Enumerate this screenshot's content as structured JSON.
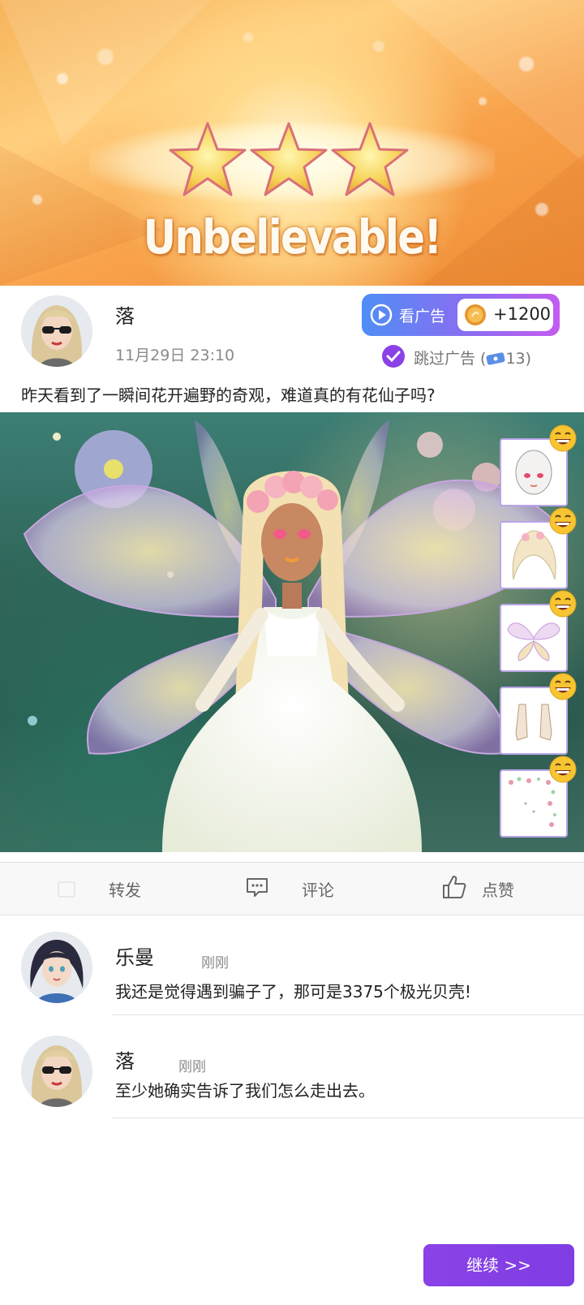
{
  "banner": {
    "stars_earned": 3,
    "stars_total": 3,
    "title": "Unbelievable!"
  },
  "post": {
    "author": "落",
    "timestamp": "11月29日 23:10",
    "text": "昨天看到了一瞬间花开遍野的奇观，难道真的有花仙子吗?",
    "watch_ad_label": "看广告",
    "reward_amount": "+1200",
    "skip_ad_label": "跳过广告 (",
    "skip_ad_count": "13)"
  },
  "outfit_items": [
    {
      "name": "face-item",
      "rating_icon": "laughing-emoji-icon"
    },
    {
      "name": "hair-item",
      "rating_icon": "laughing-emoji-icon"
    },
    {
      "name": "wings-item",
      "rating_icon": "laughing-emoji-icon"
    },
    {
      "name": "shoes-item",
      "rating_icon": "laughing-emoji-icon"
    },
    {
      "name": "background-item",
      "rating_icon": "laughing-emoji-icon"
    }
  ],
  "actions": {
    "share_label": "转发",
    "comment_label": "评论",
    "like_label": "点赞"
  },
  "comments": [
    {
      "author": "乐曼",
      "time": "刚刚",
      "text": "我还是觉得遇到骗子了，那可是3375个极光贝壳!"
    },
    {
      "author": "落",
      "time": "刚刚",
      "text": "至少她确实告诉了我们怎么走出去。"
    }
  ],
  "continue_label": "继续 >>",
  "colors": {
    "accent_purple": "#7f3de3",
    "banner_orange": "#f8a24b",
    "ad_gradient_start": "#4f8ef5",
    "ad_gradient_end": "#c45cf0"
  }
}
